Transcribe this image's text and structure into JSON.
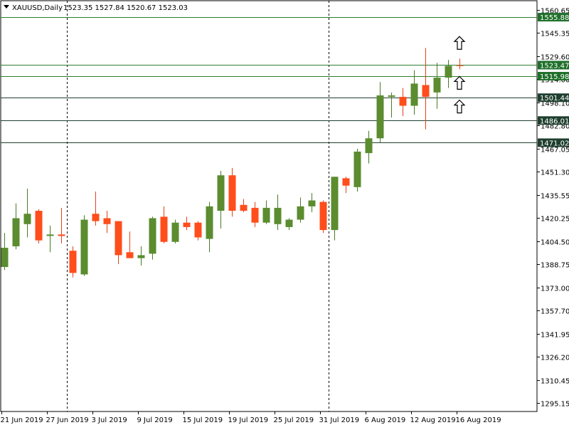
{
  "header": {
    "symbol": "XAUUSD,Daily",
    "ohlc": "1523.35 1527.84 1520.67 1523.03"
  },
  "colors": {
    "bull": "#5b8c2f",
    "bear": "#ff4d1c",
    "bull_wick": "#4a7a26",
    "bear_wick": "#e0421a",
    "level_line": "#2f7d30",
    "level_fill": "#1f6f2a",
    "level_dark": "#1f3f2f",
    "axis": "#000000"
  },
  "chart_data": {
    "type": "candlestick",
    "ylim": [
      1289.35,
      1567.0
    ],
    "y_ticks": [
      1560.65,
      1545.35,
      1529.6,
      1514.0,
      1498.1,
      1482.8,
      1467.05,
      1451.3,
      1435.55,
      1420.25,
      1404.5,
      1388.75,
      1373.0,
      1357.7,
      1341.95,
      1326.2,
      1310.45,
      1295.15
    ],
    "x_labels": [
      {
        "label": "21 Jun 2019",
        "index": 0
      },
      {
        "label": "27 Jun 2019",
        "index": 4
      },
      {
        "label": "3 Jul 2019",
        "index": 8
      },
      {
        "label": "9 Jul 2019",
        "index": 12
      },
      {
        "label": "15 Jul 2019",
        "index": 16
      },
      {
        "label": "19 Jul 2019",
        "index": 20
      },
      {
        "label": "25 Jul 2019",
        "index": 24
      },
      {
        "label": "31 Jul 2019",
        "index": 28
      },
      {
        "label": "6 Aug 2019",
        "index": 32
      },
      {
        "label": "12 Aug 2019",
        "index": 36
      },
      {
        "label": "16 Aug 2019",
        "index": 40
      }
    ],
    "vertical_markers": [
      6,
      29
    ],
    "candles": [
      {
        "o": 1387,
        "h": 1410,
        "l": 1385,
        "c": 1400
      },
      {
        "o": 1401,
        "h": 1430,
        "l": 1399,
        "c": 1420
      },
      {
        "o": 1416,
        "h": 1440,
        "l": 1407,
        "c": 1423
      },
      {
        "o": 1425,
        "h": 1426,
        "l": 1403,
        "c": 1405
      },
      {
        "o": 1408,
        "h": 1415,
        "l": 1397,
        "c": 1409
      },
      {
        "o": 1409,
        "h": 1427,
        "l": 1403,
        "c": 1408
      },
      {
        "o": 1398,
        "h": 1401,
        "l": 1380,
        "c": 1383
      },
      {
        "o": 1382,
        "h": 1422,
        "l": 1381,
        "c": 1419
      },
      {
        "o": 1423,
        "h": 1438,
        "l": 1415,
        "c": 1418
      },
      {
        "o": 1420,
        "h": 1425,
        "l": 1410,
        "c": 1416
      },
      {
        "o": 1418,
        "h": 1418,
        "l": 1389,
        "c": 1395
      },
      {
        "o": 1397,
        "h": 1411,
        "l": 1393,
        "c": 1393
      },
      {
        "o": 1393,
        "h": 1401,
        "l": 1388,
        "c": 1395
      },
      {
        "o": 1396,
        "h": 1421,
        "l": 1392,
        "c": 1420
      },
      {
        "o": 1421,
        "h": 1428,
        "l": 1403,
        "c": 1404
      },
      {
        "o": 1404,
        "h": 1419,
        "l": 1403,
        "c": 1417
      },
      {
        "o": 1417,
        "h": 1421,
        "l": 1412,
        "c": 1414
      },
      {
        "o": 1417,
        "h": 1418,
        "l": 1405,
        "c": 1407
      },
      {
        "o": 1406,
        "h": 1431,
        "l": 1397,
        "c": 1428
      },
      {
        "o": 1425,
        "h": 1452,
        "l": 1413,
        "c": 1449
      },
      {
        "o": 1449,
        "h": 1454,
        "l": 1421,
        "c": 1425
      },
      {
        "o": 1429,
        "h": 1433,
        "l": 1424,
        "c": 1425
      },
      {
        "o": 1427,
        "h": 1431,
        "l": 1414,
        "c": 1417
      },
      {
        "o": 1417,
        "h": 1432,
        "l": 1416,
        "c": 1427
      },
      {
        "o": 1416,
        "h": 1436,
        "l": 1412,
        "c": 1427
      },
      {
        "o": 1414,
        "h": 1420,
        "l": 1412,
        "c": 1419
      },
      {
        "o": 1419,
        "h": 1434,
        "l": 1417,
        "c": 1428
      },
      {
        "o": 1428,
        "h": 1437,
        "l": 1424,
        "c": 1432
      },
      {
        "o": 1431,
        "h": 1432,
        "l": 1410,
        "c": 1412
      },
      {
        "o": 1412,
        "h": 1448,
        "l": 1405,
        "c": 1448
      },
      {
        "o": 1447,
        "h": 1448,
        "l": 1437,
        "c": 1442
      },
      {
        "o": 1441,
        "h": 1467,
        "l": 1438,
        "c": 1465
      },
      {
        "o": 1464,
        "h": 1479,
        "l": 1457,
        "c": 1474
      },
      {
        "o": 1474,
        "h": 1512,
        "l": 1471,
        "c": 1503
      },
      {
        "o": 1502,
        "h": 1505,
        "l": 1488,
        "c": 1503
      },
      {
        "o": 1502,
        "h": 1508,
        "l": 1489,
        "c": 1496
      },
      {
        "o": 1496,
        "h": 1520,
        "l": 1490,
        "c": 1511
      },
      {
        "o": 1510,
        "h": 1535,
        "l": 1480,
        "c": 1502
      },
      {
        "o": 1505,
        "h": 1525,
        "l": 1494,
        "c": 1515
      },
      {
        "o": 1515,
        "h": 1527,
        "l": 1508,
        "c": 1523
      },
      {
        "o": 1523.35,
        "h": 1527.84,
        "l": 1520.67,
        "c": 1523.03
      }
    ],
    "levels": [
      {
        "value": 1555.88,
        "label": "1555.88",
        "style": "green"
      },
      {
        "value": 1523.47,
        "label": "1523.47",
        "style": "green"
      },
      {
        "value": 1515.98,
        "label": "1515.98",
        "style": "green"
      },
      {
        "value": 1501.44,
        "label": "1501.44",
        "style": "dark"
      },
      {
        "value": 1486.01,
        "label": "1486.01",
        "style": "dark"
      },
      {
        "value": 1471.02,
        "label": "1471.02",
        "style": "dark"
      }
    ],
    "arrows": [
      {
        "index": 40,
        "y": 1538
      },
      {
        "index": 40,
        "y": 1511
      },
      {
        "index": 40,
        "y": 1495
      }
    ]
  }
}
